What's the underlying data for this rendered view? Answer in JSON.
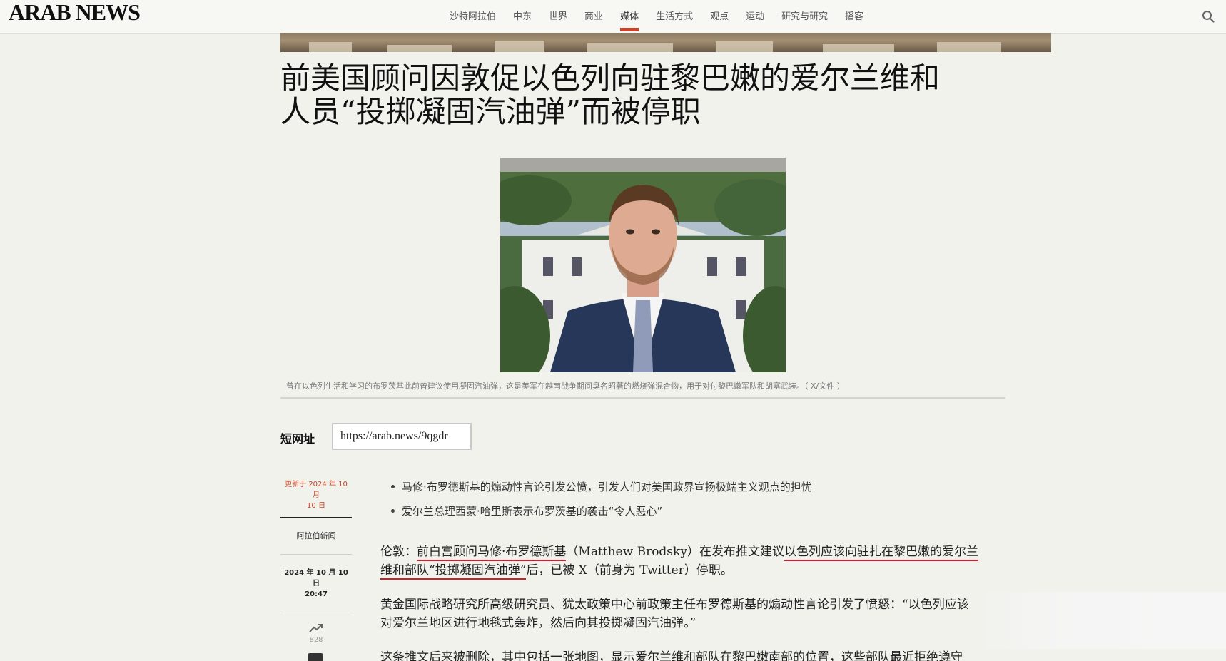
{
  "header": {
    "logo": "ARAB NEWS",
    "nav": [
      "沙特阿拉伯",
      "中东",
      "世界",
      "商业",
      "媒体",
      "生活方式",
      "观点",
      "运动",
      "研究与研究",
      "播客"
    ],
    "active_index": 4
  },
  "article": {
    "headline_line1": "前美国顾问因敦促以色列向驻黎巴嫩的爱尔兰维和",
    "headline_line2": "人员“投掷凝固汽油弹”而被停职",
    "caption": "曾在以色列生活和学习的布罗茨基此前曾建议使用凝固汽油弹，这是美军在越南战争期间臭名昭著的燃烧弹混合物，用于对付黎巴嫩军队和胡塞武装。（ X/文件 ）",
    "short_url_label": "短网址",
    "short_url": "https://arab.news/9qgdr",
    "meta": {
      "updated_line1": "更新于 2024 年 10 月",
      "updated_line2": "10 日",
      "source": "阿拉伯新闻",
      "date_line1": "2024 年 10 月 10 日",
      "date_line2": "20:47",
      "views": "828"
    },
    "bullets": [
      "马修·布罗德斯基的煽动性言论引发公愤，引发人们对美国政界宣扬极端主义观点的担忧",
      "爱尔兰总理西蒙·哈里斯表示布罗茨基的袭击“令人恶心”"
    ],
    "p1": {
      "lead": "伦敦：",
      "u1": "前白宫顾问马修·布罗德斯基",
      "mid": "（Matthew Brodsky）在发布推文建议",
      "u2": "以色列应该向驻扎在黎巴嫩的爱尔兰",
      "u3": "维和部队“投掷凝固汽油弹”",
      "tail": "后，已被 X（前身为 Twitter）停职。"
    },
    "p2_line1": "黄金国际战略研究所高级研究员、犹太政策中心前政策主任布罗德斯基的煽动性言论引发了愤怒：“以色列应该",
    "p2_line2": "对爱尔兰地区进行地毯式轰炸，然后向其投掷凝固汽油弹。”",
    "p3": "这条推文后来被删除，其中包括一张地图，显示爱尔兰维和部队在黎巴嫩南部的位置，这些部队最近拒绝遵守"
  },
  "colors": {
    "accent": "#c8432a",
    "underline_annotation": "#d01c2b",
    "background": "#f1f2ec"
  }
}
